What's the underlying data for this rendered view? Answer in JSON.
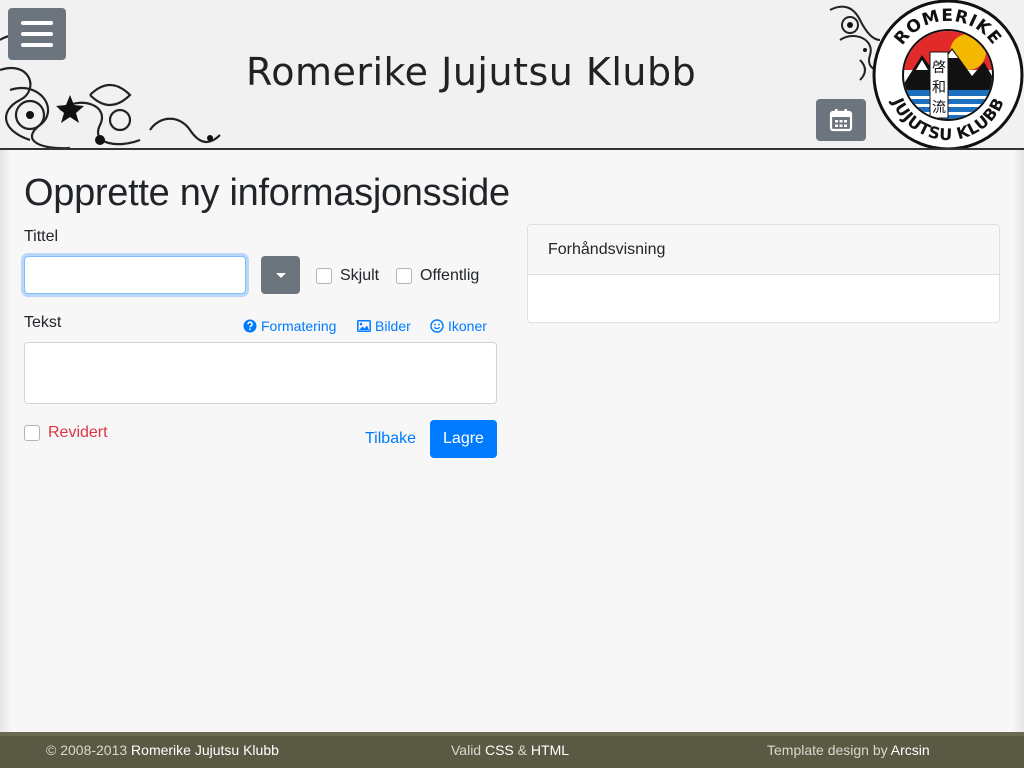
{
  "header": {
    "site_title": "Romerike Jujutsu Klubb",
    "logo_text_top": "ROMERIKE",
    "logo_text_bottom": "JUJUTSU KLUBB",
    "logo_kanji": "啓和流"
  },
  "page": {
    "title": "Opprette ny informasjonsside"
  },
  "form": {
    "title_label": "Tittel",
    "title_value": "",
    "hidden_label": "Skjult",
    "public_label": "Offentlig",
    "text_label": "Tekst",
    "text_value": "",
    "tools": {
      "formatting": "Formatering",
      "images": "Bilder",
      "icons": "Ikoner"
    },
    "revised_label": "Revidert",
    "back_label": "Tilbake",
    "save_label": "Lagre"
  },
  "preview": {
    "header": "Forhåndsvisning"
  },
  "footer": {
    "copyright_prefix": "© 2008-2013",
    "copyright_name": "Romerike Jujutsu Klubb",
    "valid_prefix": "Valid",
    "valid_css": "CSS",
    "valid_amp": "&",
    "valid_html": "HTML",
    "template_prefix": "Template design by",
    "template_author": "Arcsin"
  },
  "colors": {
    "primary": "#007bff",
    "secondary_btn": "#6c757d",
    "revised_text": "#dc3545",
    "footer_bg": "#5a5a44"
  },
  "icons": {
    "menu": "hamburger-icon",
    "calendar": "calendar-icon",
    "formatting": "question-circle-icon",
    "images": "image-icon",
    "icons": "smiley-icon"
  }
}
